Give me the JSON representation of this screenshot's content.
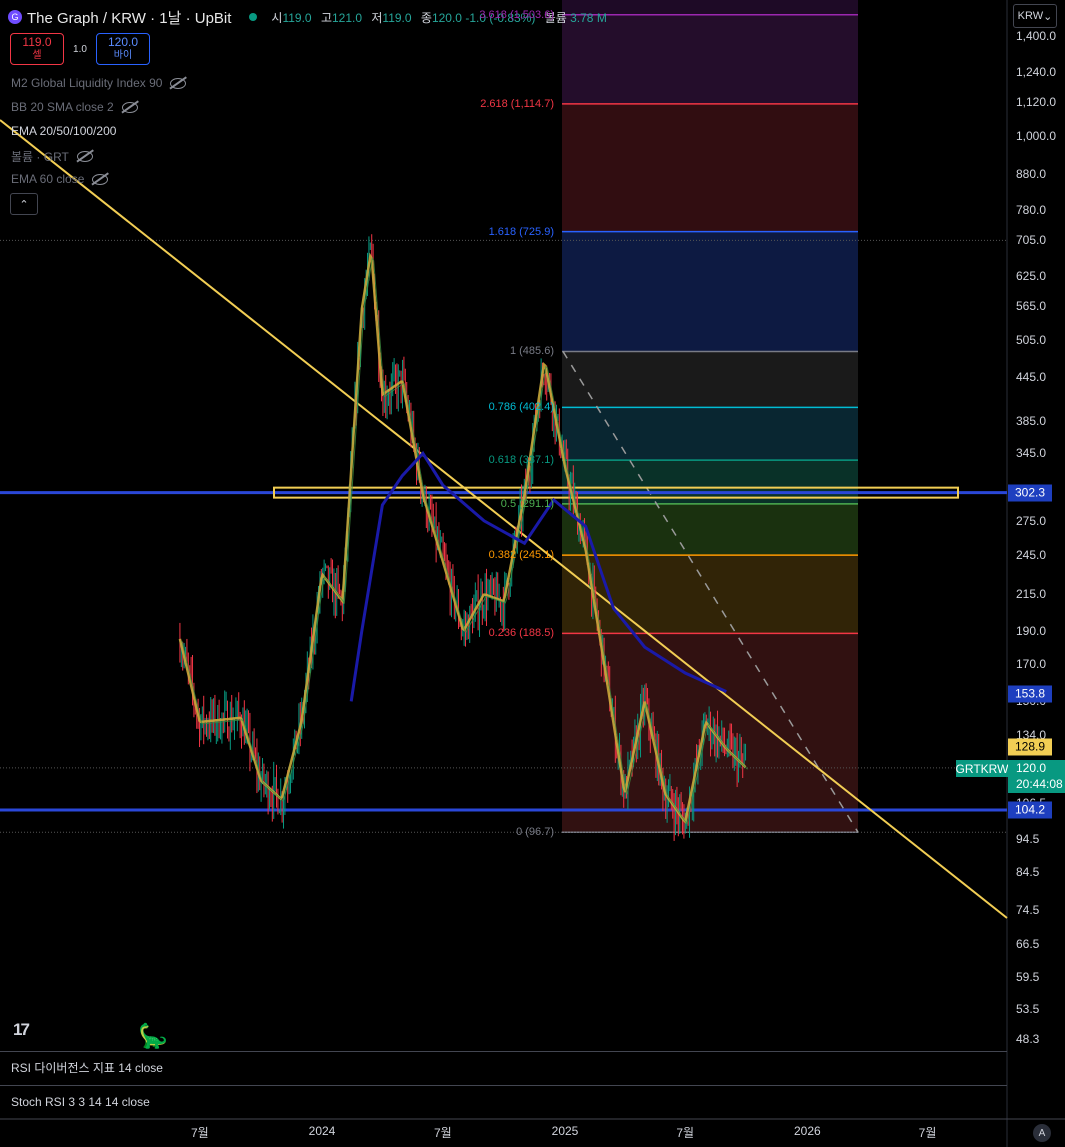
{
  "header": {
    "logo_text": "G",
    "title": "The Graph / KRW · 1날 · UpBit",
    "ohlc": [
      {
        "label": "시",
        "value": "119.0"
      },
      {
        "label": "고",
        "value": "121.0"
      },
      {
        "label": "저",
        "value": "119.0"
      },
      {
        "label": "종",
        "value": "120.0 -1.0 (-0.83%)"
      }
    ],
    "volume_label": "볼륨",
    "volume_value": "3.78 M"
  },
  "trade": {
    "sell_price": "119.0",
    "sell_label": "셀",
    "spread": "1.0",
    "buy_price": "120.0",
    "buy_label": "바이"
  },
  "indicators": [
    {
      "label": "M2 Global Liquidity Index 90",
      "visible": false
    },
    {
      "label": "BB 20 SMA close 2",
      "visible": false
    },
    {
      "label": "EMA 20/50/100/200",
      "visible": true
    },
    {
      "label": "볼륨 · GRT",
      "visible": false
    },
    {
      "label": "EMA 60 close",
      "visible": false
    }
  ],
  "currency_selector": "KRW",
  "y_axis": {
    "scale": "log",
    "range": [
      46,
      1550
    ],
    "ticks": [
      "1,400.0",
      "1,240.0",
      "1,120.0",
      "1,000.0",
      "880.0",
      "780.0",
      "705.0",
      "625.0",
      "565.0",
      "505.0",
      "445.0",
      "385.0",
      "345.0",
      "302.3",
      "275.0",
      "245.0",
      "215.0",
      "190.0",
      "170.0",
      "153.8",
      "150.0",
      "134.0",
      "128.9",
      "120.0",
      "106.5",
      "104.2",
      "94.5",
      "84.5",
      "74.5",
      "66.5",
      "59.5",
      "53.5",
      "48.3"
    ]
  },
  "price_badges": [
    {
      "value": "302.3",
      "bg": "#1e3fbf"
    },
    {
      "value": "153.8",
      "bg": "#1e3fbf"
    },
    {
      "value": "128.9",
      "bg": "#f2ce54"
    },
    {
      "value": "104.2",
      "bg": "#1e3fbf"
    }
  ],
  "symbol_badge": {
    "symbol": "GRTKRW",
    "price": "120.0",
    "countdown": "20:44:08",
    "bg": "#089981"
  },
  "fib_levels": [
    {
      "label": "3.618 (1,503.6)",
      "price": 1503.6,
      "color": "#9c27b0"
    },
    {
      "label": "2.618 (1,114.7)",
      "price": 1114.7,
      "color": "#f23645"
    },
    {
      "label": "1.618 (725.9)",
      "price": 725.9,
      "color": "#2962ff"
    },
    {
      "label": "1 (485.6)",
      "price": 485.6,
      "color": "#787b86"
    },
    {
      "label": "0.786 (402.4)",
      "price": 402.4,
      "color": "#00bcd4"
    },
    {
      "label": "0.618 (337.1)",
      "price": 337.1,
      "color": "#089981"
    },
    {
      "label": "0.5 (291.1)",
      "price": 291.1,
      "color": "#4caf50"
    },
    {
      "label": "0.382 (245.1)",
      "price": 245.1,
      "color": "#ff9800"
    },
    {
      "label": "0.236 (188.5)",
      "price": 188.5,
      "color": "#f23645"
    },
    {
      "label": "0 (96.7)",
      "price": 96.7,
      "color": "#787b86"
    }
  ],
  "horizontal_lines": [
    302.3,
    104.2
  ],
  "panes": [
    {
      "label": "RSI 다이버전스 지표 14 close"
    },
    {
      "label": "Stoch RSI 3 3 14 14 close"
    }
  ],
  "x_axis": {
    "labels": [
      "7월",
      "2024",
      "7월",
      "2025",
      "7월",
      "2026",
      "7월"
    ]
  },
  "chart_data": {
    "type": "candlestick",
    "series_hint": "daily GRT/KRW price with EMA overlays (approximate)",
    "close_path": [
      {
        "date": "2023-06",
        "price": 185
      },
      {
        "date": "2023-07",
        "price": 140
      },
      {
        "date": "2023-09",
        "price": 142
      },
      {
        "date": "2023-10",
        "price": 115
      },
      {
        "date": "2023-11",
        "price": 108
      },
      {
        "date": "2023-12",
        "price": 140
      },
      {
        "date": "2024-01",
        "price": 230
      },
      {
        "date": "2024-02",
        "price": 210
      },
      {
        "date": "2024-03",
        "price": 560
      },
      {
        "date": "2024-03-15",
        "price": 680
      },
      {
        "date": "2024-04",
        "price": 420
      },
      {
        "date": "2024-05",
        "price": 440
      },
      {
        "date": "2024-06",
        "price": 300
      },
      {
        "date": "2024-07",
        "price": 240
      },
      {
        "date": "2024-08",
        "price": 190
      },
      {
        "date": "2024-09",
        "price": 215
      },
      {
        "date": "2024-10",
        "price": 210
      },
      {
        "date": "2024-11",
        "price": 300
      },
      {
        "date": "2024-12",
        "price": 470
      },
      {
        "date": "2025-01",
        "price": 330
      },
      {
        "date": "2025-02",
        "price": 250
      },
      {
        "date": "2025-03",
        "price": 170
      },
      {
        "date": "2025-04",
        "price": 110
      },
      {
        "date": "2025-05",
        "price": 150
      },
      {
        "date": "2025-06",
        "price": 110
      },
      {
        "date": "2025-07",
        "price": 100
      },
      {
        "date": "2025-08",
        "price": 140
      },
      {
        "date": "2025-09",
        "price": 128
      },
      {
        "date": "2025-10",
        "price": 120
      }
    ]
  },
  "colors": {
    "background": "#000000",
    "up": "#089981",
    "down": "#f23645",
    "trendline": "#f2ce54",
    "ema_long": "#1a1aa8",
    "ema_short": "#c9a83a"
  }
}
